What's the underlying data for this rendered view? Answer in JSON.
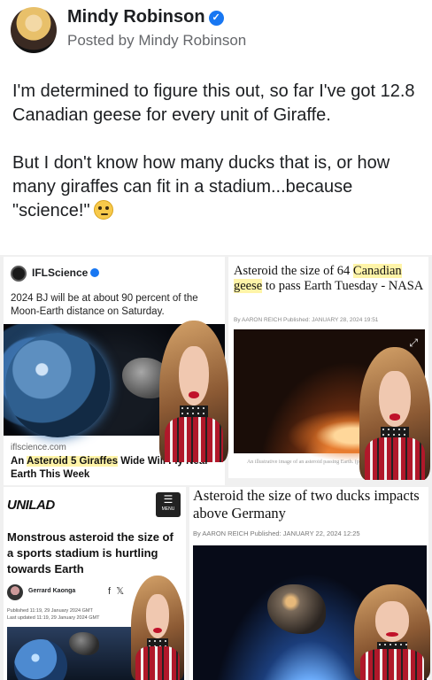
{
  "post": {
    "author": "Mindy Robinson",
    "posted_by": "Posted by Mindy Robinson",
    "paragraph1": "I'm determined to figure this out, so far I've got 12.8 Canadian geese for every unit of Giraffe.",
    "paragraph2": "But I don't know how many ducks that is, or how many giraffes can fit in a stadium...because \"science!\""
  },
  "panels": {
    "ifl": {
      "source": "IFLScience",
      "description": "2024 BJ will be at about 90 percent of the Moon-Earth distance on Saturday.",
      "domain": "iflscience.com",
      "title_pre": "An ",
      "title_highlight": "Asteroid 5 Giraffes",
      "title_post": " Wide Will Fly Near Earth This Week"
    },
    "nasa": {
      "title_pre": "Asteroid the size of 64 ",
      "title_highlight": "Canadian geese",
      "title_post": " to pass Earth Tuesday - NASA",
      "byline": "By AARON REICH   Published: JANUARY 28, 2024 19:51",
      "caption": "An illustrative image of an asteroid passing Earth. (photo credit: INGIMAGE)"
    },
    "unilad": {
      "logo": "UNILAD",
      "menu": "MENU",
      "title": "Monstrous asteroid the size of a sports stadium is hurtling towards Earth",
      "author": "Gerrard Kaonga",
      "published": "Published 11:19, 29 January 2024 GMT",
      "updated": "Last updated 11:19, 29 January 2024 GMT"
    },
    "ducks": {
      "title": "Asteroid the size of two ducks impacts above Germany",
      "byline": "By AARON REICH   Published: JANUARY 22, 2024 12:25"
    }
  },
  "icons": {
    "verified": "verified-badge-icon",
    "emoji": "thinking-face-emoji",
    "expand": "expand-icon",
    "menu": "hamburger-menu-icon",
    "facebook": "facebook-icon",
    "x": "x-icon"
  },
  "colors": {
    "verified_blue": "#1877f2",
    "text": "#1c1e21",
    "secondary_text": "#65676b",
    "highlight": "#fff4a8"
  }
}
